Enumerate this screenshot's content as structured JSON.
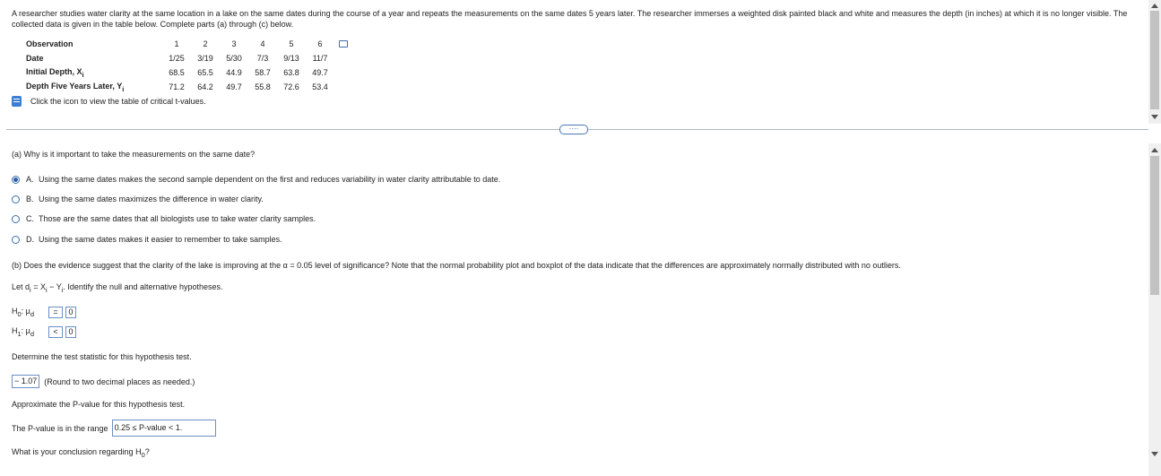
{
  "intro": "A researcher studies water clarity at the same location in a lake on the same dates during the course of a year and repeats the measurements on the same dates 5 years later. The researcher immerses a weighted disk painted black and white and measures the depth (in inches) at which it is no longer visible. The collected data is given in the table below. Complete parts (a) through (c) below.",
  "table": {
    "observation_label": "Observation",
    "date_label": "Date",
    "initial_label": "Initial Depth, X",
    "initial_sub": "i",
    "later_label": "Depth Five Years Later, Y",
    "later_sub": "i",
    "observations": [
      "1",
      "2",
      "3",
      "4",
      "5",
      "6"
    ],
    "dates": [
      "1/25",
      "3/19",
      "5/30",
      "7/3",
      "9/13",
      "11/7"
    ],
    "initial": [
      "68.5",
      "65.5",
      "44.9",
      "58.7",
      "63.8",
      "49.7"
    ],
    "later": [
      "71.2",
      "64.2",
      "49.7",
      "55.8",
      "72.6",
      "53.4"
    ]
  },
  "critical_link": "Click the icon to view the table of critical t-values.",
  "more_button": "····",
  "part_a": {
    "question": "(a) Why is it important to take the measurements on the same date?",
    "options": [
      {
        "letter": "A.",
        "text": "Using the same dates makes the second sample dependent on the first and reduces variability in water clarity attributable to date.",
        "selected": true
      },
      {
        "letter": "B.",
        "text": "Using the same dates maximizes the difference in water clarity.",
        "selected": false
      },
      {
        "letter": "C.",
        "text": "Those are the same dates that all biologists use to take water clarity samples.",
        "selected": false
      },
      {
        "letter": "D.",
        "text": "Using the same dates makes it easier to remember to take samples.",
        "selected": false
      }
    ]
  },
  "part_b": {
    "question": "(b) Does the evidence suggest that the clarity of the lake is improving at the α = 0.05 level of significance? Note that the normal probability plot and boxplot of the data indicate that the differences are approximately normally distributed with no outliers.",
    "let_d": "Let d",
    "let_d_sub": "i",
    "let_rest": " = X",
    "let_rest_sub": "i",
    "let_minus": " − Y",
    "let_minus_sub": "i",
    "let_tail": ". Identify the null and alternative hypotheses.",
    "h0_label": "H",
    "h0_sub": "0",
    "h1_label": "H",
    "h1_sub": "1",
    "mu": ": μ",
    "mu_sub": "d",
    "h0_op": "=",
    "h0_val": "0",
    "h1_op": "<",
    "h1_val": "0",
    "test_stat_prompt": "Determine the test statistic for this hypothesis test.",
    "test_stat_value": "− 1.07",
    "test_stat_note": "(Round to two decimal places as needed.)",
    "pvalue_prompt": "Approximate the P-value for this hypothesis test.",
    "pvalue_range_label": "The P-value is in the range",
    "pvalue_range_value": "0.25 ≤ P-value < 1.",
    "conclusion_prompt": "What is your conclusion regarding H",
    "conclusion_sub": "0",
    "conclusion_tail": "?"
  }
}
